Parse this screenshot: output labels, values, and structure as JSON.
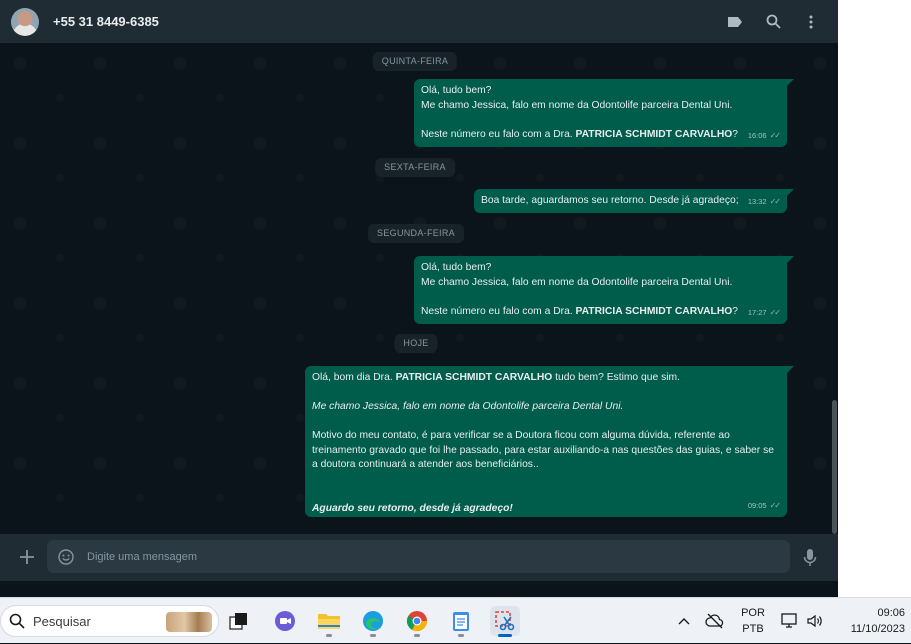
{
  "header": {
    "contact": "+55 31 8449-6385",
    "icons": [
      "label-icon",
      "search-icon",
      "more-vert-icon"
    ]
  },
  "dates": {
    "d1": "QUINTA-FEIRA",
    "d2": "SEXTA-FEIRA",
    "d3": "SEGUNDA-FEIRA",
    "d4": "HOJE"
  },
  "messages": {
    "m1": {
      "line1": "Olá, tudo bem?",
      "line2": "Me chamo Jessica, falo em nome da Odontolife parceira Dental Uni.",
      "line3_pre": "Neste número eu falo com a Dra. ",
      "line3_bold": "PATRICIA SCHMIDT CARVALHO",
      "line3_post": "?",
      "time": "16:06"
    },
    "m2": {
      "text": "Boa tarde, aguardamos seu retorno. Desde já agradeço;",
      "time": "13:32"
    },
    "m3": {
      "line1": "Olá, tudo bem?",
      "line2": "Me chamo Jessica, falo em nome da Odontolife parceira Dental Uni.",
      "line3_pre": "Neste número eu falo com a Dra. ",
      "line3_bold": "PATRICIA SCHMIDT CARVALHO",
      "line3_post": "?",
      "time": "17:27"
    },
    "m4": {
      "l1_pre": "Olá, bom dia Dra. ",
      "l1_bold": "PATRICIA SCHMIDT CARVALHO",
      "l1_post": " tudo bem? Estimo que sim.",
      "l2_italic": "Me chamo Jessica, falo em nome da Odontolife parceira Dental Uni.",
      "l3a": "Motivo do meu contato, é para verificar se a Doutora ficou com alguma dúvida, referente ao",
      "l3b": "treinamento gravado que foi lhe passado, para estar auxiliando-a nas questões das guias, e saber se",
      "l3c": "a doutora continuará a atender aos beneficiários..",
      "l4_bolditalic": "Aguardo seu retorno, desde já agradeço!",
      "time": "09:05"
    }
  },
  "composer": {
    "placeholder": "Digite uma mensagem"
  },
  "taskbar": {
    "search_label": "Pesquisar",
    "lang_line1": "POR",
    "lang_line2": "PTB",
    "time": "09:06",
    "date": "11/10/2023"
  },
  "colors": {
    "outgoing_bubble": "#005c4b",
    "header_bg": "#202c33",
    "chat_bg": "#0b141a"
  }
}
